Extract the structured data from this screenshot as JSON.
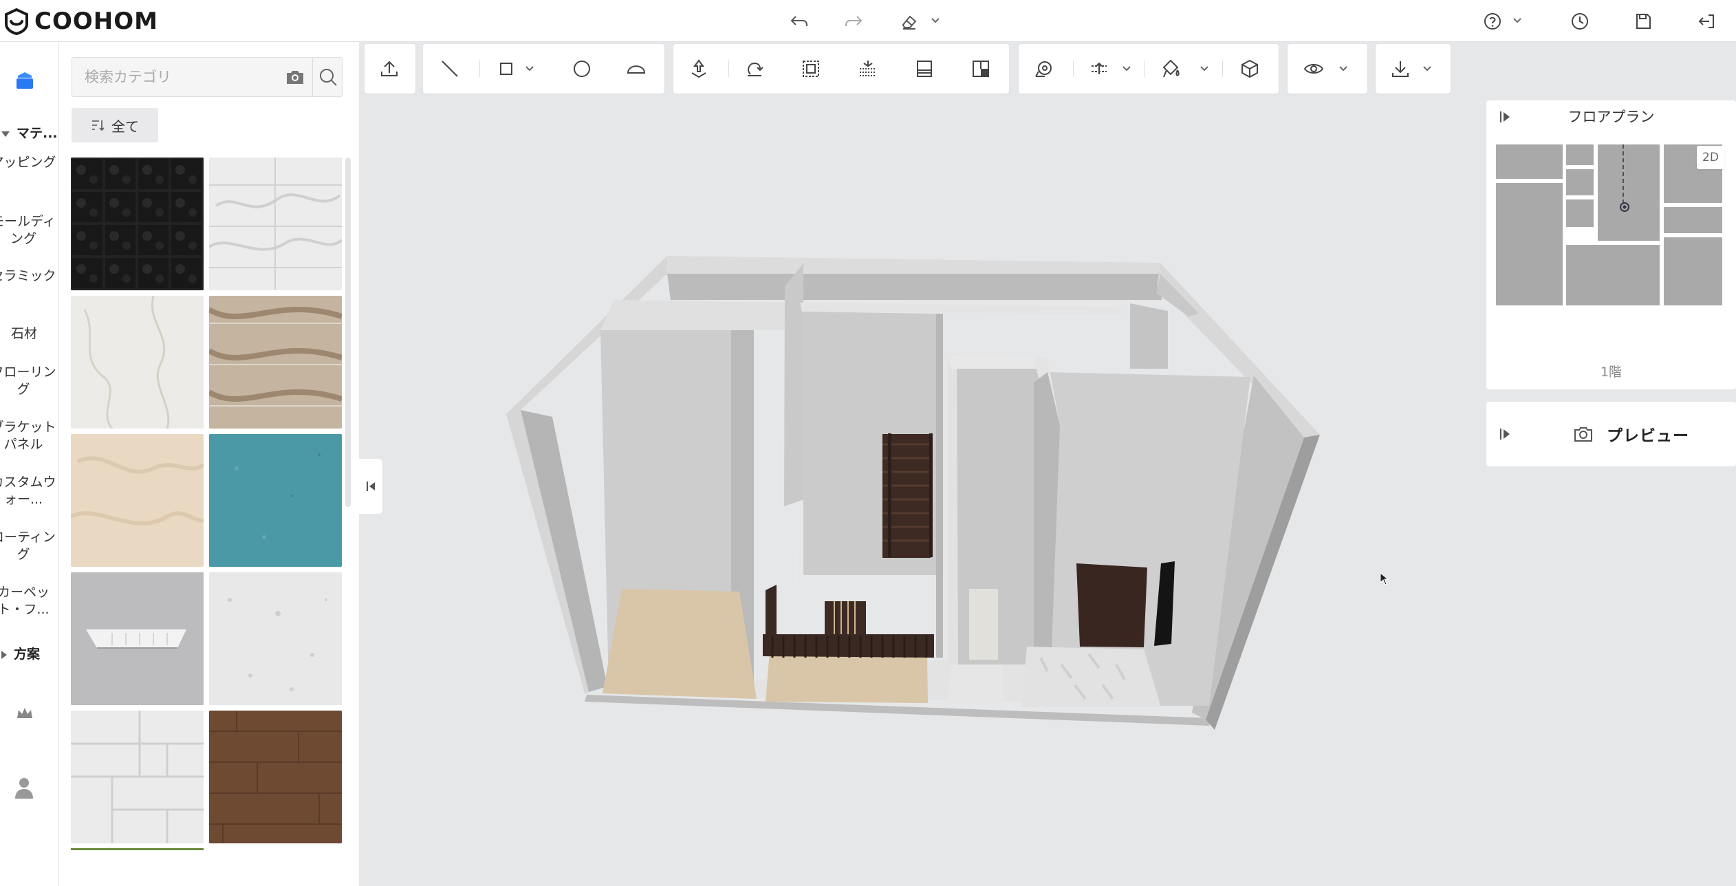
{
  "app": {
    "logo_text": "COOHOM"
  },
  "header": {
    "icons": [
      "undo-icon",
      "redo-icon",
      "eraser-icon",
      "help-icon",
      "history-icon",
      "save-icon",
      "exit-icon"
    ]
  },
  "rail": {
    "sections": [
      {
        "label": "マテ..."
      },
      {
        "label": "方案"
      }
    ],
    "items": [
      {
        "label": "マッピング"
      },
      {
        "label": "モールディング"
      },
      {
        "label": "セラミック"
      },
      {
        "label": "石材"
      },
      {
        "label": "フローリング"
      },
      {
        "label": "ブラケットパネル"
      },
      {
        "label": "カスタムウォー..."
      },
      {
        "label": "コーティング"
      },
      {
        "label": "カーペット・フ..."
      }
    ]
  },
  "catalog": {
    "search_placeholder": "検索カテゴリ",
    "all_label": "全て",
    "tiles": [
      {
        "name": "black-marble-tile",
        "color": "#1f1f1f"
      },
      {
        "name": "white-marble-tile",
        "color": "#e6e6e6"
      },
      {
        "name": "cream-marble-tile",
        "color": "#e9e6e1"
      },
      {
        "name": "brown-marble-tile",
        "color": "#b9a58c"
      },
      {
        "name": "beige-marble-tile",
        "color": "#e8d8c1"
      },
      {
        "name": "teal-stone-tile",
        "color": "#4a98a5"
      },
      {
        "name": "ceiling-panel-tile",
        "color": "#b9b9bb"
      },
      {
        "name": "white-stone-tile",
        "color": "#e2e2e2"
      },
      {
        "name": "white-tile-pattern",
        "color": "#e4e4e4"
      },
      {
        "name": "dark-wood-tile",
        "color": "#6f4a32"
      }
    ]
  },
  "toolbar": {
    "groups": [
      [
        "upload-icon"
      ],
      [
        "line-icon",
        "rectangle-icon",
        "circle-icon",
        "arc-icon"
      ],
      [
        "move-icon",
        "rotate-icon",
        "select-area-icon",
        "align-icon",
        "panel-icon",
        "split-icon"
      ],
      [
        "measure-icon",
        "level-icon",
        "paint-icon",
        "cube-icon"
      ],
      [
        "view-icon"
      ],
      [
        "download-icon"
      ]
    ]
  },
  "floorplan": {
    "title": "フロアプラン",
    "mode_label": "2D",
    "floor_label": "1階"
  },
  "preview": {
    "label": "プレビュー"
  }
}
